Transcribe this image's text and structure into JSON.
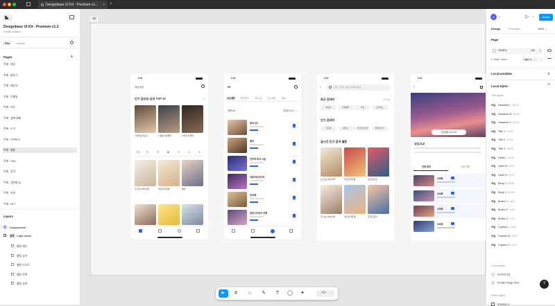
{
  "tab": {
    "title": "Designbase UI Kit - Premium v1..."
  },
  "file": {
    "name": "Designbase UI Kit - Premium v1.2",
    "subtitle": "Design System"
  },
  "left_tabs": [
    "File",
    "Assets"
  ],
  "pages": {
    "title": "Pages",
    "items": [
      "주제 : 패딩",
      "주제 : 블로그",
      "주제 : 메신저",
      "주제 : 이메일",
      "주제 : 지도",
      "주제 : 생화 예매",
      "주제 : OTT",
      "주제 : 이커머스",
      "주제 : 웹툰",
      "주제 : SNS",
      "주제 : 음악",
      "주제 : 생성형 AI",
      "주제 : 커뮤",
      "주제 : NFT"
    ]
  },
  "layers": {
    "title": "Layers",
    "components": "Components",
    "webtoon": "웹툰 - Light mode",
    "children": [
      "웹툰-메인",
      "웹툰-뷰어",
      "웹툰-리스트",
      "웹툰-목록",
      "웹툰-검색"
    ]
  },
  "canvas": {
    "frame_label": "웹툰"
  },
  "phones": {
    "time": "9:41",
    "p1": {
      "header": "오늘 추천",
      "section": "인기 급상승 남성 TOP 10",
      "ranks": [
        "1",
        "2",
        "3"
      ],
      "rank_titles": [
        "1 빛의프리스트",
        "2 동현나로물전",
        "3 치즈의 회자"
      ],
      "cats": [
        "전체",
        "월",
        "화",
        "수",
        "목",
        "금",
        "토"
      ],
      "grid": [
        "강 오브 하이스콜",
        "치즈인더트랩",
        "썸타"
      ]
    },
    "p2": {
      "title": "MY",
      "tabs": [
        "관심웹툰",
        "관심작가",
        "최근 본",
        "임시저장",
        "댓글"
      ],
      "count_label": "전체",
      "count": "24",
      "sort": "업데이트 순",
      "items": [
        "빛의시트",
        "별하",
        "전지적 독자 시점",
        "허분자로우주의",
        "전혀재",
        "빛하스트로우 전쟁"
      ]
    },
    "p3": {
      "search_placeholder": "인물, 키워드, 웹툰 검색해보세요",
      "recent": "최근 검색어",
      "delete_all": "전체 삭제",
      "recent_chips": [
        "빛프리",
        "산림웹툰",
        "막지",
        "노블레스"
      ],
      "popular": "인기 검색어",
      "popular_chips": [
        "가요리",
        "4에4고",
        "치즈인더트랩",
        "위타이오우"
      ],
      "realtime": "실시간 인기 검색 웹툰",
      "grid": [
        "강 오브 하이스콜",
        "치즈인더트랩",
        "프리드로우"
      ]
    },
    "p4": {
      "title": "상남고교",
      "chip": "관심웹툰 245,304",
      "tabs": [
        "전체 회차",
        "관련 작품"
      ],
      "episodes": [
        "205화",
        "204화",
        "203화",
        "202화"
      ]
    }
  },
  "right": {
    "tabs": [
      "Design",
      "Prototype"
    ],
    "zoom": "69%",
    "share": "Share",
    "avatar": "S",
    "page_title": "Page",
    "page_color": "F5F5F5",
    "page_opacity": "100",
    "opacity_unit": "%",
    "alias": "2. Alias Token",
    "alias_value": "Light m...",
    "local_variables": "Local variables",
    "local_styles": "Local styles",
    "text_styles_title": "Text styles",
    "text_styles": [
      {
        "n": "Headline L",
        "s": "36/129"
      },
      {
        "n": "Headline M",
        "s": "32/123"
      },
      {
        "n": "Headline S",
        "s": "28/125"
      },
      {
        "n": "Title 1",
        "s": "24/125"
      },
      {
        "n": "Title 2",
        "s": "22/125"
      },
      {
        "n": "Title 3",
        "s": "18/125"
      },
      {
        "n": "Label L",
        "s": "16/24"
      },
      {
        "n": "Label M",
        "s": "14/20"
      },
      {
        "n": "Label S",
        "s": "12/20"
      },
      {
        "n": "Body 1",
        "s": "16/180"
      },
      {
        "n": "Body 2",
        "s": "14/180"
      },
      {
        "n": "Button 1",
        "s": "16/24"
      },
      {
        "n": "Button 2",
        "s": "14/20"
      },
      {
        "n": "Button 3",
        "s": "12/20"
      },
      {
        "n": "Caption L",
        "s": "16/24"
      },
      {
        "n": "Caption M",
        "s": "14/20"
      },
      {
        "n": "Caption S",
        "s": "12/20"
      }
    ],
    "ag": "Ag",
    "color_styles_title": "Color styles",
    "color_styles": [
      "Section-bg",
      "Empty Image Area"
    ],
    "effect_styles_title": "Effect styles",
    "effect_styles": [
      "Shadow-1"
    ],
    "help": "?"
  },
  "colors": {
    "accent": "#0d99ff",
    "dark": "#2c2c2c"
  }
}
